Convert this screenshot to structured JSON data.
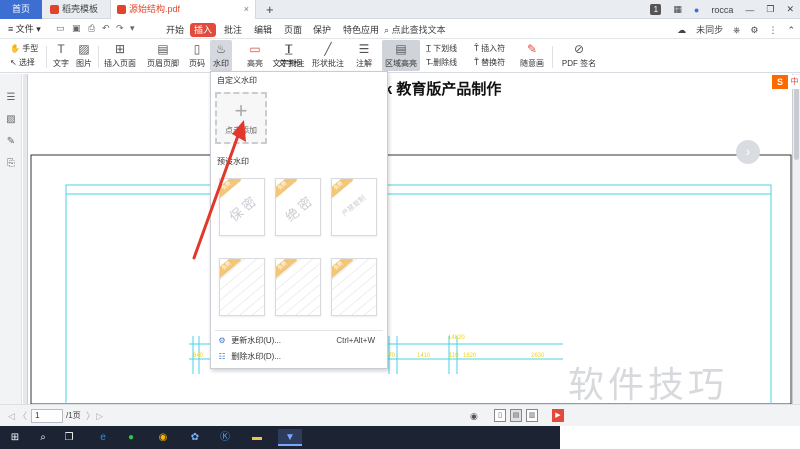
{
  "tabs": {
    "home": "首页",
    "template": "稻壳模板",
    "pdf": "源始结构.pdf",
    "close": "×",
    "add": "+"
  },
  "window": {
    "badge": "1",
    "user": "rocca"
  },
  "menubar": {
    "file": "≡ 文件 ▾",
    "items": [
      "开始",
      "插入",
      "批注",
      "编辑",
      "页面",
      "保护",
      "特色应用"
    ],
    "search": "点此查找文本",
    "sync": "未同步"
  },
  "toolbar": {
    "hand": "手型",
    "select": "选择",
    "text": "文字",
    "image": "图片",
    "insert_page": "插入页面",
    "header_footer": "页眉页脚",
    "page_num": "页码",
    "watermark": "水印",
    "highlight": "高亮",
    "text_box": "文字框",
    "text_annot": "文字批注",
    "shape_annot": "形状批注",
    "annot": "注解",
    "area_highlight": "区域高亮",
    "underline": "下划线",
    "strikethrough": "删除线",
    "insert_char": "插入符",
    "replace_char": "替换符",
    "freehand": "随意画",
    "pdf_sign": "PDF 签名"
  },
  "watermark_menu": {
    "custom_title": "自定义水印",
    "add_label": "点击添加",
    "preset_title": "预设水印",
    "presets": [
      {
        "text": "保 密",
        "tag": "免费"
      },
      {
        "text": "绝 密",
        "tag": "免费"
      },
      {
        "text": "严禁复制",
        "tag": "免费"
      },
      {
        "text": "",
        "tag": "免费"
      },
      {
        "text": "",
        "tag": "免费"
      },
      {
        "text": "",
        "tag": "免费"
      }
    ],
    "update_label": "更新水印(U)...",
    "update_shortcut": "Ctrl+Alt+W",
    "delete_label": "删除水印(D)..."
  },
  "document": {
    "title_text": "desk 教育版产品制作",
    "dim_labels": [
      "14820",
      "840",
      "1410",
      "2630",
      "110",
      "870",
      "1620"
    ]
  },
  "statusbar": {
    "page_current": "1",
    "page_total": "/1页"
  },
  "overlay": {
    "brand_text": "软件技巧"
  },
  "sogou": {
    "logo": "S"
  },
  "colors": {
    "accent": "#3c6fd1",
    "insert_tab": "#e34a3b",
    "arrow": "#e2372b",
    "drawing_line": "#45d3e3",
    "dim_text": "#f0d21a"
  }
}
